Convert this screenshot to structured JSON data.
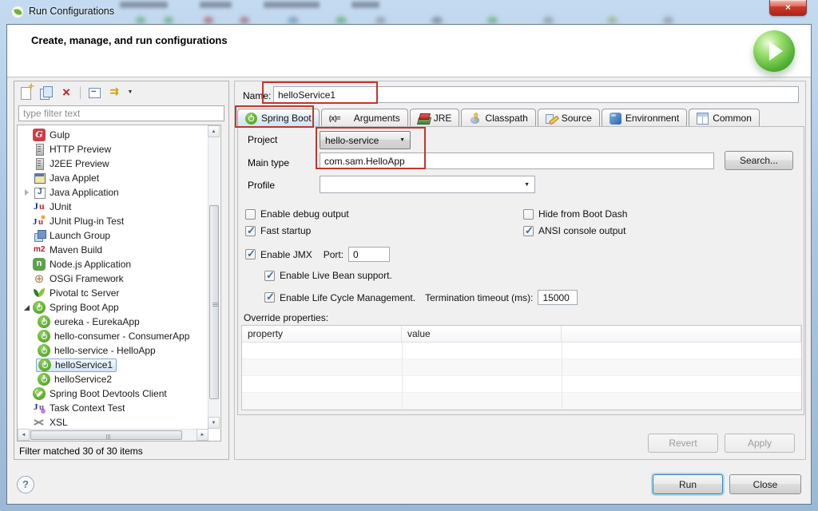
{
  "window": {
    "title": "Run Configurations",
    "close_glyph": "×"
  },
  "banner": {
    "title": "Create, manage, and run configurations"
  },
  "left_panel": {
    "toolbar": {
      "icons": [
        "new-configuration",
        "duplicate",
        "delete",
        "collapse-all",
        "filter-launch-configurations",
        "view-menu"
      ]
    },
    "filter": {
      "placeholder": "type filter text"
    },
    "tree": [
      {
        "label": "Gulp",
        "icon": "gulp"
      },
      {
        "label": "HTTP Preview",
        "icon": "server"
      },
      {
        "label": "J2EE Preview",
        "icon": "server"
      },
      {
        "label": "Java Applet",
        "icon": "java-applet"
      },
      {
        "label": "Java Application",
        "icon": "java-application",
        "arrow": "collapsed"
      },
      {
        "label": "JUnit",
        "icon": "junit"
      },
      {
        "label": "JUnit Plug-in Test",
        "icon": "junit-plugin"
      },
      {
        "label": "Launch Group",
        "icon": "launch-group"
      },
      {
        "label": "Maven Build",
        "icon": "maven"
      },
      {
        "label": "Node.js Application",
        "icon": "nodejs"
      },
      {
        "label": "OSGi Framework",
        "icon": "osgi"
      },
      {
        "label": "Pivotal tc Server",
        "icon": "pivotal"
      },
      {
        "label": "Spring Boot App",
        "icon": "spring-boot",
        "arrow": "expanded"
      },
      {
        "label": "eureka - EurekaApp",
        "icon": "spring-boot",
        "level": 2
      },
      {
        "label": "hello-consumer - ConsumerApp",
        "icon": "spring-boot",
        "level": 2
      },
      {
        "label": "hello-service - HelloApp",
        "icon": "spring-boot",
        "level": 2
      },
      {
        "label": "helloService1",
        "icon": "spring-boot",
        "level": 2,
        "selected": true
      },
      {
        "label": "helloService2",
        "icon": "spring-boot",
        "level": 2
      },
      {
        "label": "Spring Boot Devtools Client",
        "icon": "devtools"
      },
      {
        "label": "Task Context Test",
        "icon": "task-context"
      },
      {
        "label": "XSL",
        "icon": "xsl"
      }
    ],
    "status": "Filter matched 30 of 30 items"
  },
  "form": {
    "name_label": "Name:",
    "name_value": "helloService1",
    "tabs": [
      {
        "label": "Spring Boot",
        "icon": "spring-boot",
        "selected": true
      },
      {
        "label": "Arguments",
        "icon": "arguments"
      },
      {
        "label": "JRE",
        "icon": "jre"
      },
      {
        "label": "Classpath",
        "icon": "classpath"
      },
      {
        "label": "Source",
        "icon": "source"
      },
      {
        "label": "Environment",
        "icon": "environment"
      },
      {
        "label": "Common",
        "icon": "common"
      }
    ],
    "project": {
      "label": "Project",
      "value": "hello-service"
    },
    "main_type": {
      "label": "Main type",
      "value": "com.sam.HelloApp",
      "search_button": "Search..."
    },
    "profile": {
      "label": "Profile",
      "value": ""
    },
    "checkboxes": {
      "debug": {
        "label": "Enable debug output",
        "checked": false
      },
      "boot_dash": {
        "label": "Hide from Boot Dash",
        "checked": false
      },
      "fast": {
        "label": "Fast startup",
        "checked": true
      },
      "ansi": {
        "label": "ANSI console output",
        "checked": true
      },
      "jmx": {
        "label": "Enable JMX",
        "checked": true
      },
      "live_bean": {
        "label": "Enable Live Bean support.",
        "checked": true
      },
      "lifecycle": {
        "label": "Enable Life Cycle Management.",
        "checked": true
      }
    },
    "port": {
      "label": "Port:",
      "value": "0"
    },
    "termination": {
      "label": "Termination timeout (ms):",
      "value": "15000"
    },
    "override": {
      "label": "Override properties:",
      "columns": [
        "property",
        "value"
      ]
    },
    "revert_button": "Revert",
    "apply_button": "Apply"
  },
  "footer": {
    "help": "?",
    "run_button": "Run",
    "close_button": "Close"
  },
  "annotations": {
    "color": "#c0362c"
  }
}
